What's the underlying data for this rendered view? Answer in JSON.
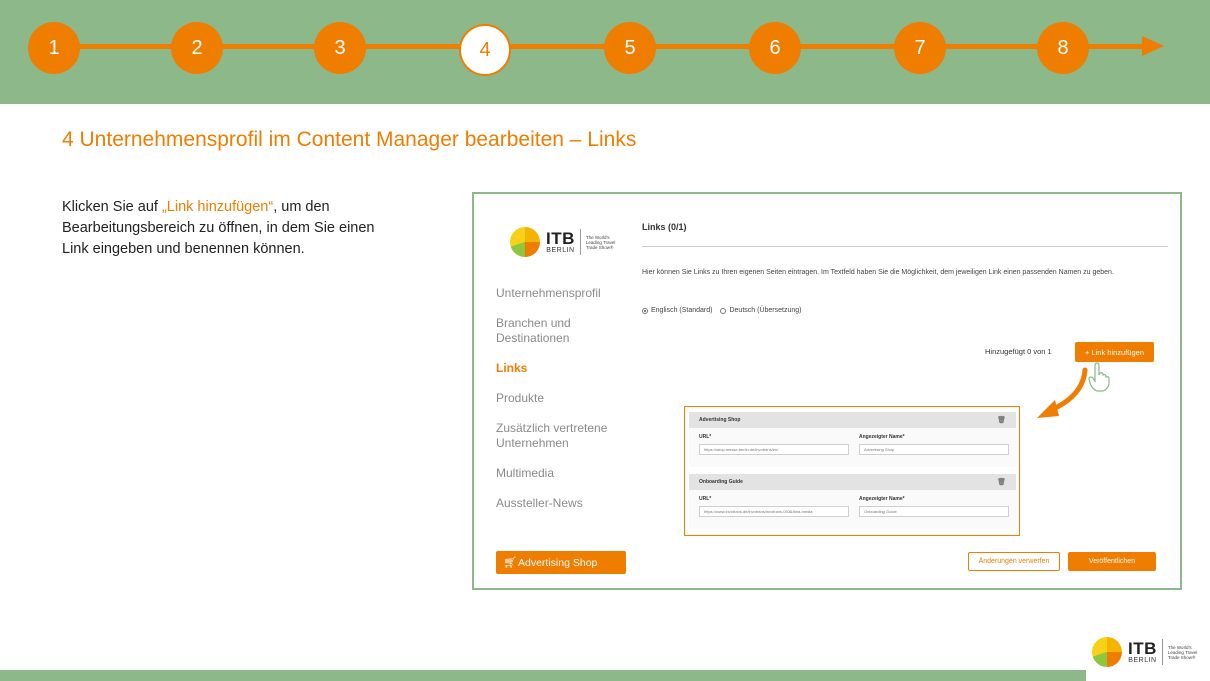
{
  "steps": [
    "1",
    "2",
    "3",
    "4",
    "5",
    "6",
    "7",
    "8"
  ],
  "active_step": "4",
  "headline": "4 Unternehmensprofil im Content Manager bearbeiten – Links",
  "instruction": {
    "before": "Klicken Sie auf ",
    "highlight": "„Link hinzufügen“",
    "after": ", um den Bearbeitungsbereich zu öffnen, in dem Sie einen Link eingeben und benennen können."
  },
  "logo": {
    "wordmark": "ITB",
    "city": "BERLIN",
    "tagline": "The World's Leading Travel Trade Show®"
  },
  "sidebar": {
    "items": [
      {
        "label": "Unternehmensprofil",
        "active": false
      },
      {
        "label": "Branchen und Destinationen",
        "active": false
      },
      {
        "label": "Links",
        "active": true
      },
      {
        "label": "Produkte",
        "active": false
      },
      {
        "label": "Zusätzlich vertretene Unternehmen",
        "active": false
      },
      {
        "label": "Multimedia",
        "active": false
      },
      {
        "label": "Aussteller-News",
        "active": false
      }
    ],
    "shop_button": "Advertising Shop"
  },
  "main": {
    "title": "Links (0/1)",
    "description": "Hier können Sie Links zu Ihren eigenen Seiten eintragen. Im Textfeld haben Sie die Möglichkeit, dem jeweiligen Link einen passenden Namen zu geben.",
    "languages": [
      {
        "label": "Englisch (Standard)",
        "selected": true
      },
      {
        "label": "Deutsch (Übersetzung)",
        "selected": false
      }
    ],
    "counter": "Hinzugefügt 0 von 1",
    "add_button": "+ Link hinzufügen",
    "entries": [
      {
        "header": "Advertising Shop",
        "url_label": "URL*",
        "url_value": "https://shop.messe-berlin.de/invotrans/en/",
        "name_label": "Angezeigter Name*",
        "name_value": "Advertising Shop"
      },
      {
        "header": "Onboarding Guide",
        "url_label": "URL*",
        "url_value": "https://www.invotrans.de/invotrans/invotrans-003&itma-media",
        "name_label": "Angezeigter Name*",
        "name_value": "Onboarding Guide"
      }
    ],
    "discard_button": "Änderungen verwerfen",
    "publish_button": "Veröffentlichen"
  },
  "colors": {
    "accent": "#ee7d00",
    "band": "#8db88a"
  }
}
